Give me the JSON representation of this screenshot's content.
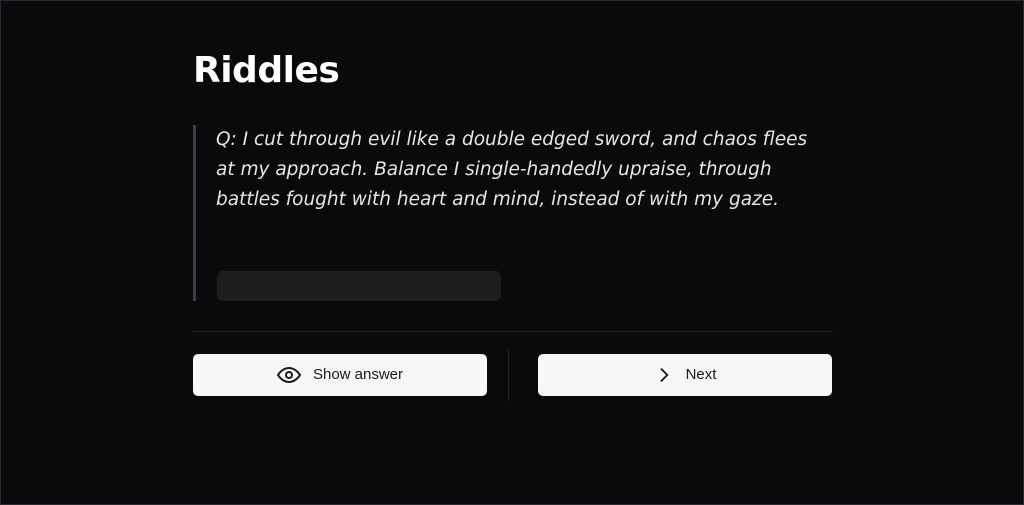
{
  "header": {
    "title": "Riddles"
  },
  "riddle": {
    "question": "Q: I cut through evil like a double edged sword, and chaos flees at my approach. Balance I single-handedly upraise, through battles fought with heart and mind, instead of with my gaze.",
    "answer_hidden": true
  },
  "actions": {
    "show_answer_label": "Show answer",
    "show_answer_icon": "eye-icon",
    "next_label": "Next",
    "next_icon": "chevron-right-icon"
  },
  "colors": {
    "background": "#0a0a0c",
    "button_bg": "#f7f7f7",
    "quote_border": "#3a3d44",
    "placeholder": "#1d1d20"
  }
}
